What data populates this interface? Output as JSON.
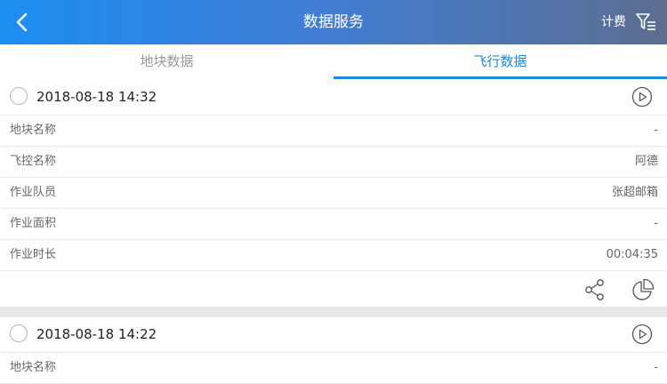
{
  "header": {
    "title": "数据服务",
    "billing_label": "计费",
    "back_icon": "chevron-left-icon",
    "filter_icon": "filter-icon"
  },
  "tabs": [
    {
      "label": "地块数据",
      "active": false
    },
    {
      "label": "飞行数据",
      "active": true
    }
  ],
  "records": [
    {
      "time": "2018-08-18 14:32",
      "fields": [
        {
          "label": "地块名称",
          "value": "-"
        },
        {
          "label": "飞控名称",
          "value": "阿德"
        },
        {
          "label": "作业队员",
          "value": "张超邮箱"
        },
        {
          "label": "作业面积",
          "value": "-"
        },
        {
          "label": "作业时长",
          "value": "00:04:35"
        }
      ]
    },
    {
      "time": "2018-08-18 14:22",
      "fields": [
        {
          "label": "地块名称",
          "value": "-"
        }
      ]
    }
  ],
  "colors": {
    "accent": "#1f86dc",
    "header_start": "#1b8ef0",
    "header_end": "#5c6d90",
    "separator": "#e8e8e8"
  }
}
